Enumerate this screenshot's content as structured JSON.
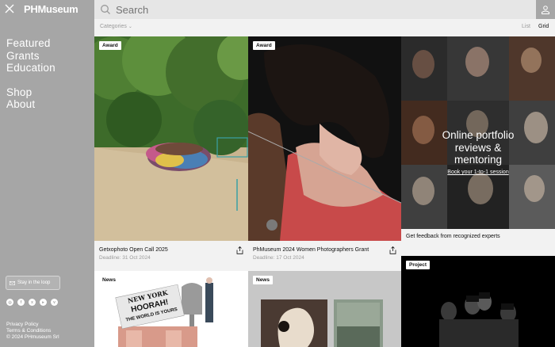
{
  "sidebar": {
    "logo": "PHMuseum",
    "nav_primary": [
      "Featured",
      "Grants",
      "Education"
    ],
    "nav_secondary": [
      "Shop",
      "About"
    ],
    "stay_label": "Stay in the loop",
    "legal": [
      "Privacy Policy",
      "Terms & Conditions",
      "© 2024 PHmuseum Srl"
    ]
  },
  "search": {
    "placeholder": "Search"
  },
  "filters": {
    "categories_label": "Categories",
    "view_list": "List",
    "view_grid": "Grid"
  },
  "cards": [
    {
      "badge": "Award",
      "title": "Getxophoto Open Call 2025",
      "subtitle": "Deadline: 31 Oct 2024"
    },
    {
      "badge": "Award",
      "title": "PhMuseum 2024 Women Photographers Grant",
      "subtitle": "Deadline: 17 Oct 2024"
    }
  ],
  "promo": {
    "headline_lines": [
      "Online portfolio",
      "reviews &",
      "mentoring"
    ],
    "link": "Book your 1-to-1 session",
    "footer": "Get feedback from recognized experts"
  },
  "bottom_cards": [
    {
      "badge": "News",
      "newspaper_text": [
        "NEW YORK",
        "HOORAH!",
        "THE WORLD IS YOURS"
      ]
    },
    {
      "badge": "News"
    },
    {
      "badge": "Project"
    }
  ],
  "colors": {
    "sidebar": "#a6a6a6",
    "background": "#f2f2f2",
    "search": "#e6e6e6"
  }
}
